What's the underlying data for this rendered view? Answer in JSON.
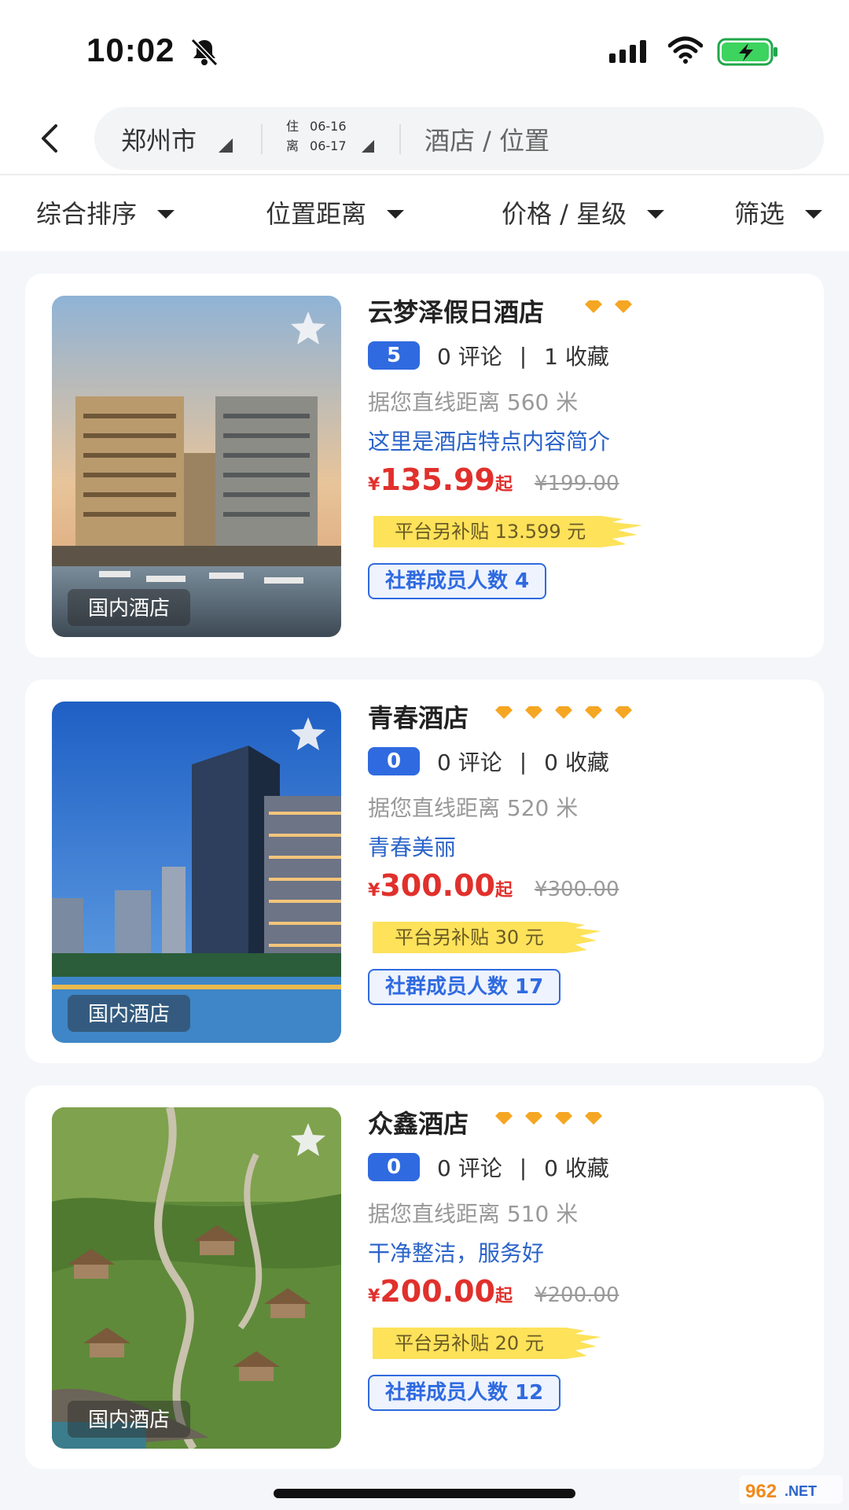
{
  "status_bar": {
    "time": "10:02"
  },
  "header": {
    "city": "郑州市",
    "checkin_label": "住",
    "checkin_date": "06-16",
    "checkout_label": "离",
    "checkout_date": "06-17",
    "search_placeholder": "酒店 / 位置"
  },
  "filters": [
    {
      "label": "综合排序"
    },
    {
      "label": "位置距离"
    },
    {
      "label": "价格 / 星级"
    },
    {
      "label": "筛选"
    }
  ],
  "hotels": [
    {
      "name": "云梦泽假日酒店",
      "stars": 2,
      "score": "5",
      "comments": "0 评论",
      "sep": "|",
      "favorites": "1 收藏",
      "distance": "据您直线距离 560 米",
      "description": "这里是酒店特点内容简介",
      "currency": "¥",
      "price": "135.99",
      "price_suffix": "起",
      "original_price": "¥199.00",
      "subsidy": "平台另补贴 13.599 元",
      "members": "社群成员人数  4",
      "tag": "国内酒店"
    },
    {
      "name": "青春酒店",
      "stars": 5,
      "score": "0",
      "comments": "0 评论",
      "sep": "|",
      "favorites": "0 收藏",
      "distance": "据您直线距离 520 米",
      "description": "青春美丽",
      "currency": "¥",
      "price": "300.00",
      "price_suffix": "起",
      "original_price": "¥300.00",
      "subsidy": "平台另补贴 30 元",
      "members": "社群成员人数  17",
      "tag": "国内酒店"
    },
    {
      "name": "众鑫酒店",
      "stars": 4,
      "score": "0",
      "comments": "0 评论",
      "sep": "|",
      "favorites": "0 收藏",
      "distance": "据您直线距离 510 米",
      "description": "干净整洁，服务好",
      "currency": "¥",
      "price": "200.00",
      "price_suffix": "起",
      "original_price": "¥200.00",
      "subsidy": "平台另补贴 20 元",
      "members": "社群成员人数  12",
      "tag": "国内酒店"
    }
  ],
  "colors": {
    "accent_blue": "#2f6ae0",
    "price_red": "#e1302c",
    "star_orange": "#f5a623",
    "subsidy_yellow": "#fde25a"
  },
  "watermark": "962.NET"
}
